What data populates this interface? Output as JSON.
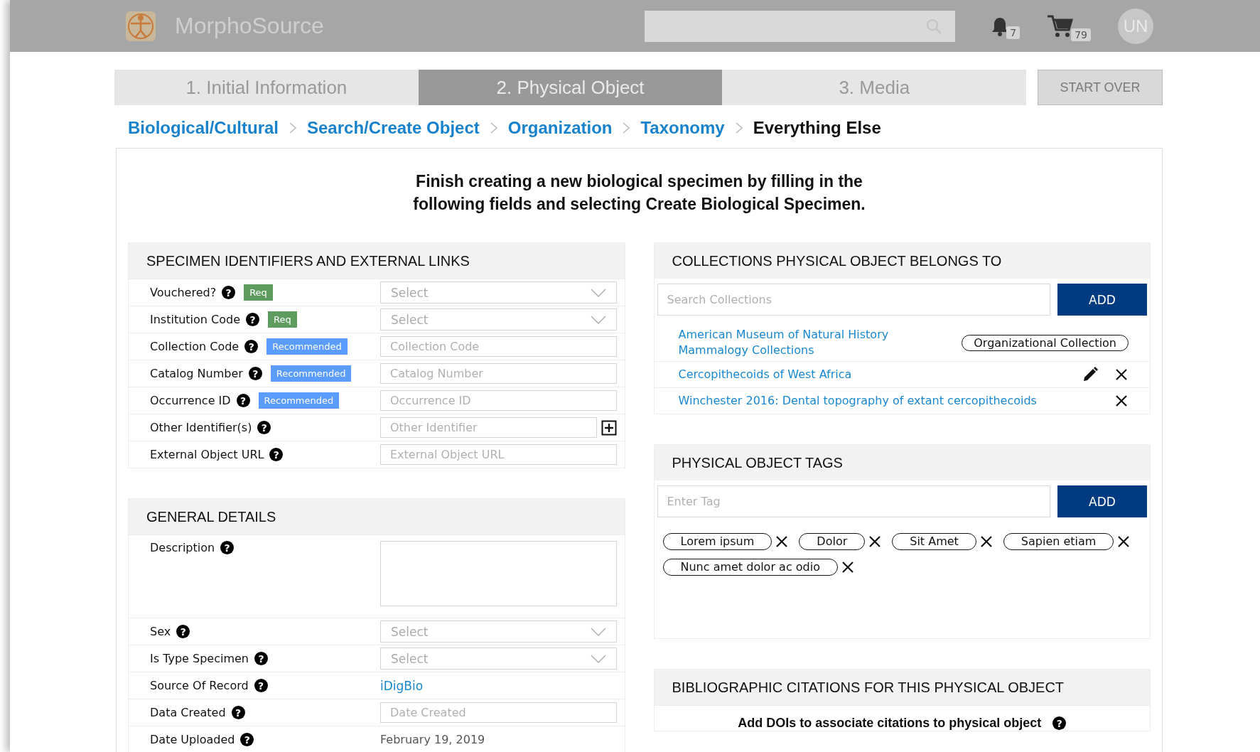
{
  "header": {
    "logo_text": "MorphoSource",
    "notification_count": "7",
    "cart_count": "79",
    "avatar_initials": "UN"
  },
  "steps": [
    {
      "label": "1. Initial Information",
      "selected": false
    },
    {
      "label": "2. Physical Object",
      "selected": true
    },
    {
      "label": "3. Media",
      "selected": false
    }
  ],
  "start_over": "START OVER",
  "breadcrumb": [
    {
      "label": "Biological/Cultural",
      "selected": false
    },
    {
      "label": "Search/Create Object",
      "selected": false
    },
    {
      "label": "Organization",
      "selected": false
    },
    {
      "label": "Taxonomy",
      "selected": false
    },
    {
      "label": "Everything Else",
      "selected": true
    }
  ],
  "intro": "Finish creating a new biological specimen by filling in the following fields and selecting Create Biological Specimen.",
  "identifiers": {
    "title": "SPECIMEN IDENTIFIERS AND EXTERNAL LINKS",
    "rows": [
      {
        "label": "Vouchered?",
        "help": "?",
        "badge": {
          "kind": "req",
          "text": "Req"
        },
        "control": {
          "kind": "select",
          "placeholder": "Select"
        }
      },
      {
        "label": "Institution Code",
        "help": "?",
        "badge": {
          "kind": "req",
          "text": "Req"
        },
        "control": {
          "kind": "select",
          "placeholder": "Select"
        }
      },
      {
        "label": "Collection Code",
        "help": "?",
        "badge": {
          "kind": "recommended",
          "text": "Recommended"
        },
        "control": {
          "kind": "input",
          "placeholder": "Collection Code"
        }
      },
      {
        "label": "Catalog Number",
        "help": "?",
        "badge": {
          "kind": "recommended",
          "text": "Recommended"
        },
        "control": {
          "kind": "input",
          "placeholder": "Catalog Number"
        }
      },
      {
        "label": "Occurrence ID",
        "help": "?",
        "badge": {
          "kind": "recommended",
          "text": "Recommended"
        },
        "control": {
          "kind": "input",
          "placeholder": "Occurrence ID"
        }
      },
      {
        "label": "Other Identifier(s)",
        "help": "?",
        "control": {
          "kind": "input",
          "placeholder": "Other Identifier",
          "addable": true
        }
      },
      {
        "label": "External Object URL",
        "help": "?",
        "control": {
          "kind": "input",
          "placeholder": "External Object URL"
        }
      }
    ]
  },
  "general": {
    "title": "GENERAL DETAILS",
    "rows": [
      {
        "label": "Description",
        "help": "?",
        "control": {
          "kind": "textarea"
        }
      },
      {
        "label": "Sex",
        "help": "?",
        "control": {
          "kind": "select",
          "placeholder": "Select"
        }
      },
      {
        "label": "Is Type Specimen",
        "help": "?",
        "control": {
          "kind": "select",
          "placeholder": "Select"
        }
      },
      {
        "label": "Source Of Record",
        "help": "?",
        "control": {
          "kind": "link",
          "value": "iDigBio"
        }
      },
      {
        "label": "Data Created",
        "help": "?",
        "control": {
          "kind": "input",
          "placeholder": "Date Created"
        }
      },
      {
        "label": "Date Uploaded",
        "help": "?",
        "control": {
          "kind": "text",
          "value": "February 19, 2019"
        }
      }
    ]
  },
  "collections": {
    "title": "COLLECTIONS PHYSICAL OBJECT BELONGS TO",
    "search_placeholder": "Search Collections",
    "add_label": "ADD",
    "items": [
      {
        "title": "American Museum of Natural History Mammalogy Collections",
        "tag": "Organizational Collection",
        "editable": false,
        "removable": false
      },
      {
        "title": "Cercopithecoids of West Africa",
        "editable": true,
        "removable": true
      },
      {
        "title": "Winchester 2016: Dental topography of extant cercopithecoids",
        "editable": false,
        "removable": true
      }
    ]
  },
  "tags": {
    "title": "PHYSICAL OBJECT TAGS",
    "placeholder": "Enter Tag",
    "add_label": "ADD",
    "items": [
      "Lorem ipsum",
      "Dolor",
      "Sit Amet",
      "Sapien etiam",
      "Nunc amet dolor ac odio"
    ]
  },
  "citations": {
    "title": "BIBLIOGRAPHIC CITATIONS FOR THIS PHYSICAL OBJECT",
    "prompt": "Add DOIs to associate citations to physical object",
    "help": "?"
  }
}
